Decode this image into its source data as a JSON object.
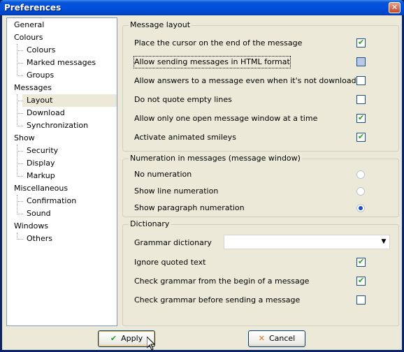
{
  "window": {
    "title": "Preferences",
    "close_glyph": "✕"
  },
  "tree": {
    "items": [
      {
        "label": "General",
        "level": 0
      },
      {
        "label": "Colours",
        "level": 0
      },
      {
        "label": "Colours",
        "level": 1
      },
      {
        "label": "Marked messages",
        "level": 1
      },
      {
        "label": "Groups",
        "level": 1
      },
      {
        "label": "Messages",
        "level": 0
      },
      {
        "label": "Layout",
        "level": 1,
        "selected": true
      },
      {
        "label": "Download",
        "level": 1
      },
      {
        "label": "Synchronization",
        "level": 1
      },
      {
        "label": "Show",
        "level": 0
      },
      {
        "label": "Security",
        "level": 1
      },
      {
        "label": "Display",
        "level": 1
      },
      {
        "label": "Markup",
        "level": 1
      },
      {
        "label": "Miscellaneous",
        "level": 0
      },
      {
        "label": "Confirmation",
        "level": 1
      },
      {
        "label": "Sound",
        "level": 1
      },
      {
        "label": "Windows",
        "level": 0
      },
      {
        "label": "Others",
        "level": 1
      }
    ]
  },
  "layout_group": {
    "title": "Message layout",
    "options": [
      {
        "label": "Place the cursor on the end of the message",
        "checked": true
      },
      {
        "label": "Allow sending messages in HTML format",
        "checked": false
      },
      {
        "label": "Allow answers to a message even when it's not downloaded",
        "checked": false
      },
      {
        "label": "Do not quote empty lines",
        "checked": false
      },
      {
        "label": "Allow only one open message window at a time",
        "checked": true
      },
      {
        "label": "Activate animated smileys",
        "checked": true
      }
    ]
  },
  "numeration_group": {
    "title": "Numeration in messages (message window)",
    "options": [
      {
        "label": "No numeration",
        "selected": false
      },
      {
        "label": "Show line numeration",
        "selected": false
      },
      {
        "label": "Show paragraph numeration",
        "selected": true
      }
    ]
  },
  "dictionary_group": {
    "title": "Dictionary",
    "grammar_label": "Grammar dictionary",
    "grammar_value": "",
    "options": [
      {
        "label": "Ignore quoted text",
        "checked": true
      },
      {
        "label": "Check grammar from the begin of a message",
        "checked": true
      },
      {
        "label": "Check grammar before sending a message",
        "checked": false
      }
    ]
  },
  "buttons": {
    "apply": "Apply",
    "cancel": "Cancel",
    "apply_icon": "check-icon",
    "cancel_icon": "cross-icon",
    "apply_color": "#21a121",
    "cancel_color": "#e0701a"
  }
}
